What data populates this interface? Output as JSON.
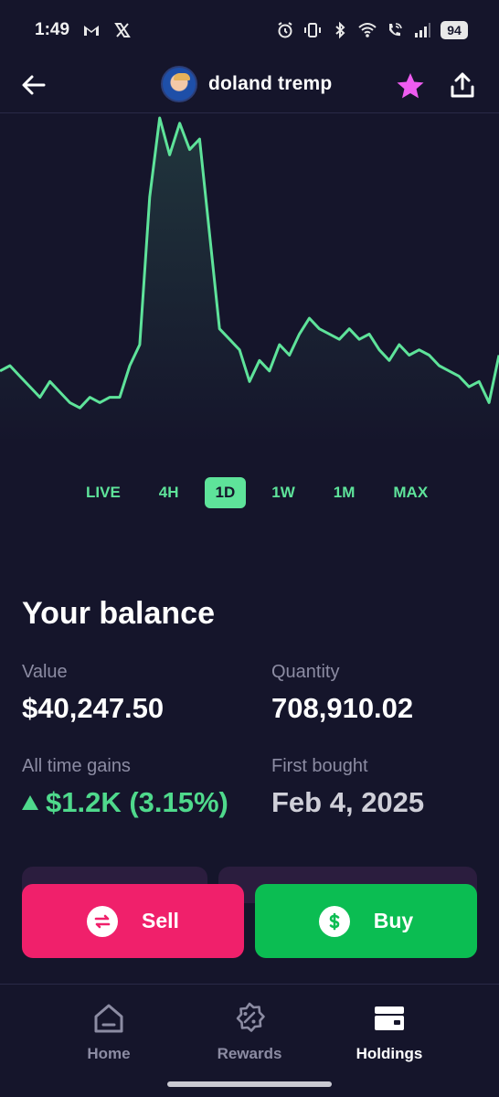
{
  "status": {
    "time": "1:49",
    "battery": "94",
    "icons": [
      "gmail-icon",
      "x-icon",
      "alarm-icon",
      "vibrate-icon",
      "bluetooth-icon",
      "wifi-icon",
      "wifi-calling-icon",
      "signal-icon"
    ]
  },
  "header": {
    "title": "doland tremp",
    "back_icon": "arrow-left-icon",
    "favorite_icon": "star-icon",
    "share_icon": "share-icon",
    "accent": "#ee5cf0"
  },
  "chart_data": {
    "type": "line",
    "line_color": "#5ee39a",
    "x": [
      0,
      2,
      4,
      6,
      8,
      10,
      12,
      14,
      16,
      18,
      20,
      22,
      24,
      26,
      28,
      30,
      32,
      34,
      36,
      38,
      40,
      42,
      44,
      46,
      48,
      50,
      52,
      54,
      56,
      58,
      60,
      62,
      64,
      66,
      68,
      70,
      72,
      74,
      76,
      78,
      80,
      82,
      84,
      86,
      88,
      90,
      92,
      94,
      96,
      98,
      100
    ],
    "y": [
      52,
      53,
      51,
      49,
      47,
      50,
      48,
      46,
      45,
      47,
      46,
      47,
      47,
      53,
      57,
      85,
      100,
      93,
      99,
      94,
      96,
      78,
      60,
      58,
      56,
      50,
      54,
      52,
      57,
      55,
      59,
      62,
      60,
      59,
      58,
      60,
      58,
      59,
      56,
      54,
      57,
      55,
      56,
      55,
      53,
      52,
      51,
      49,
      50,
      46,
      55
    ],
    "xlim": [
      0,
      100
    ],
    "ylim": [
      40,
      100
    ],
    "grid": false
  },
  "range_tabs": [
    {
      "label": "LIVE",
      "active": false
    },
    {
      "label": "4H",
      "active": false
    },
    {
      "label": "1D",
      "active": true
    },
    {
      "label": "1W",
      "active": false
    },
    {
      "label": "1M",
      "active": false
    },
    {
      "label": "MAX",
      "active": false
    }
  ],
  "balance": {
    "title": "Your balance",
    "value_label": "Value",
    "value": "$40,247.50",
    "quantity_label": "Quantity",
    "quantity": "708,910.02",
    "gains_label": "All time gains",
    "gains": "$1.2K (3.15%)",
    "first_bought_label": "First bought",
    "first_bought": "Feb 4, 2025"
  },
  "actions": {
    "sell_label": "Sell",
    "buy_label": "Buy",
    "sell_color": "#f0206b",
    "buy_color": "#0bbd52"
  },
  "nav": {
    "items": [
      {
        "label": "Home",
        "icon": "home-icon",
        "active": false
      },
      {
        "label": "Rewards",
        "icon": "rewards-icon",
        "active": false
      },
      {
        "label": "Holdings",
        "icon": "wallet-icon",
        "active": true
      }
    ]
  }
}
